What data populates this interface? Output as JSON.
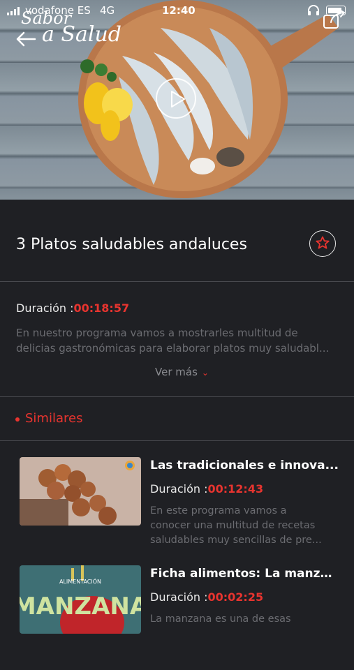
{
  "status_bar": {
    "carrier": "vodafone ES",
    "network": "4G",
    "time": "12:40"
  },
  "hero": {
    "brand_line1": "Sabor",
    "brand_line2": "a Salud",
    "icons": [
      "back-arrow-icon",
      "play-icon",
      "share-icon"
    ]
  },
  "video": {
    "title": "3 Platos saludables andaluces",
    "duration_label": "Duración :",
    "duration_value": "00:18:57",
    "description_line1": "En nuestro programa vamos a mostrarles multitud de",
    "description_line2": "delicias gastronómicas para elaborar platos muy saludabl...",
    "ver_mas": "Ver más"
  },
  "similares": {
    "label": "Similares",
    "items": [
      {
        "title": "Las tradicionales e innova...",
        "duration_label": "Duración :",
        "duration_value": "00:12:43",
        "desc_line1": "En este programa vamos a",
        "desc_line2": "conocer una multitud de recetas",
        "desc_line3": "saludables muy sencillas de pre..."
      },
      {
        "title": "Ficha alimentos: La manza...",
        "duration_label": "Duración :",
        "duration_value": "00:02:25",
        "desc_line1": "La manzana es una de esas",
        "thumb_caption_small": "ALIMENTACIÓN",
        "thumb_caption": "MANZANA"
      }
    ]
  },
  "colors": {
    "accent": "#e8342f",
    "background": "#1f2024",
    "muted_text": "#6b6c71"
  }
}
